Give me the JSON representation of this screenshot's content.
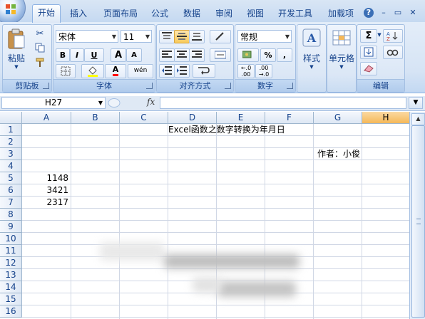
{
  "ribbon_tabs": [
    "开始",
    "插入",
    "页面布局",
    "公式",
    "数据",
    "审阅",
    "视图",
    "开发工具",
    "加载项"
  ],
  "window_controls": {
    "help": "?",
    "minimize": "–",
    "restore": "▭",
    "close": "✕"
  },
  "groups": {
    "clipboard": {
      "label": "剪贴板",
      "paste": "粘贴"
    },
    "font": {
      "label": "字体",
      "font_name": "宋体",
      "font_size": "11",
      "bold": "B",
      "italic": "I",
      "underline": "U",
      "grow": "A",
      "shrink": "A",
      "font_color_letter": "A",
      "phonetic": "wén"
    },
    "alignment": {
      "label": "对齐方式"
    },
    "number": {
      "label": "数字",
      "format": "常规",
      "percent": "%",
      "comma": ","
    },
    "styles": {
      "label": "样式"
    },
    "cells": {
      "label": "单元格"
    },
    "editing": {
      "label": "编辑",
      "sum": "Σ"
    }
  },
  "formula_bar": {
    "name_box": "H27",
    "fx": "fx",
    "formula": ""
  },
  "columns": [
    "A",
    "B",
    "C",
    "D",
    "E",
    "F",
    "G",
    "H"
  ],
  "selected_column": "H",
  "rows": [
    "1",
    "2",
    "3",
    "4",
    "5",
    "6",
    "7",
    "8",
    "9",
    "10",
    "11",
    "12",
    "13",
    "14",
    "15",
    "16"
  ],
  "cells": {
    "D1": "Excel函数之数字转换为年月日",
    "G3": "作者：小俊",
    "A5": "1148",
    "A6": "3421",
    "A7": "2317"
  },
  "colors": {
    "ribbon_text": "#15428b",
    "header_border": "#9eb6ce",
    "selected_header": "#f5b859"
  }
}
